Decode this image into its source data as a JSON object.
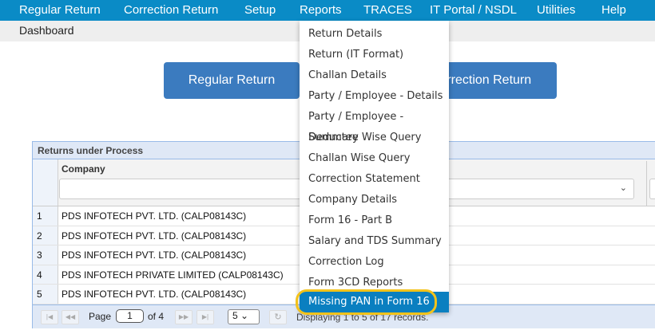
{
  "nav": [
    "Regular Return",
    "Correction Return",
    "Setup",
    "Reports",
    "TRACES",
    "IT Portal / NSDL",
    "Utilities",
    "Help"
  ],
  "breadcrumb": "Dashboard",
  "buttons": {
    "regular": "Regular Return",
    "correction": "Correction Return"
  },
  "grid": {
    "title": "Returns under Process",
    "column": "Company",
    "rows": [
      {
        "n": "1",
        "company": "PDS INFOTECH PVT. LTD. (CALP08143C)"
      },
      {
        "n": "2",
        "company": "PDS INFOTECH PVT. LTD. (CALP08143C)"
      },
      {
        "n": "3",
        "company": "PDS INFOTECH PVT. LTD. (CALP08143C)"
      },
      {
        "n": "4",
        "company": "PDS INFOTECH PRIVATE LIMITED (CALP08143C)"
      },
      {
        "n": "5",
        "company": "PDS INFOTECH PVT. LTD. (CALP08143C)"
      }
    ],
    "pager": {
      "page_label": "Page",
      "page": "1",
      "of": "of 4",
      "page_size": "5",
      "display": "Displaying 1 to 5 of 17 records."
    }
  },
  "menu": [
    "Return Details",
    "Return (IT Format)",
    "Challan Details",
    "Party / Employee - Details",
    "Party / Employee - Summary",
    "Deductee Wise Query",
    "Challan Wise Query",
    "Correction Statement",
    "Company Details",
    "Form 16 - Part B",
    "Salary and TDS Summary",
    "Correction Log",
    "Form 3CD Reports",
    "Missing PAN in Form 16"
  ]
}
